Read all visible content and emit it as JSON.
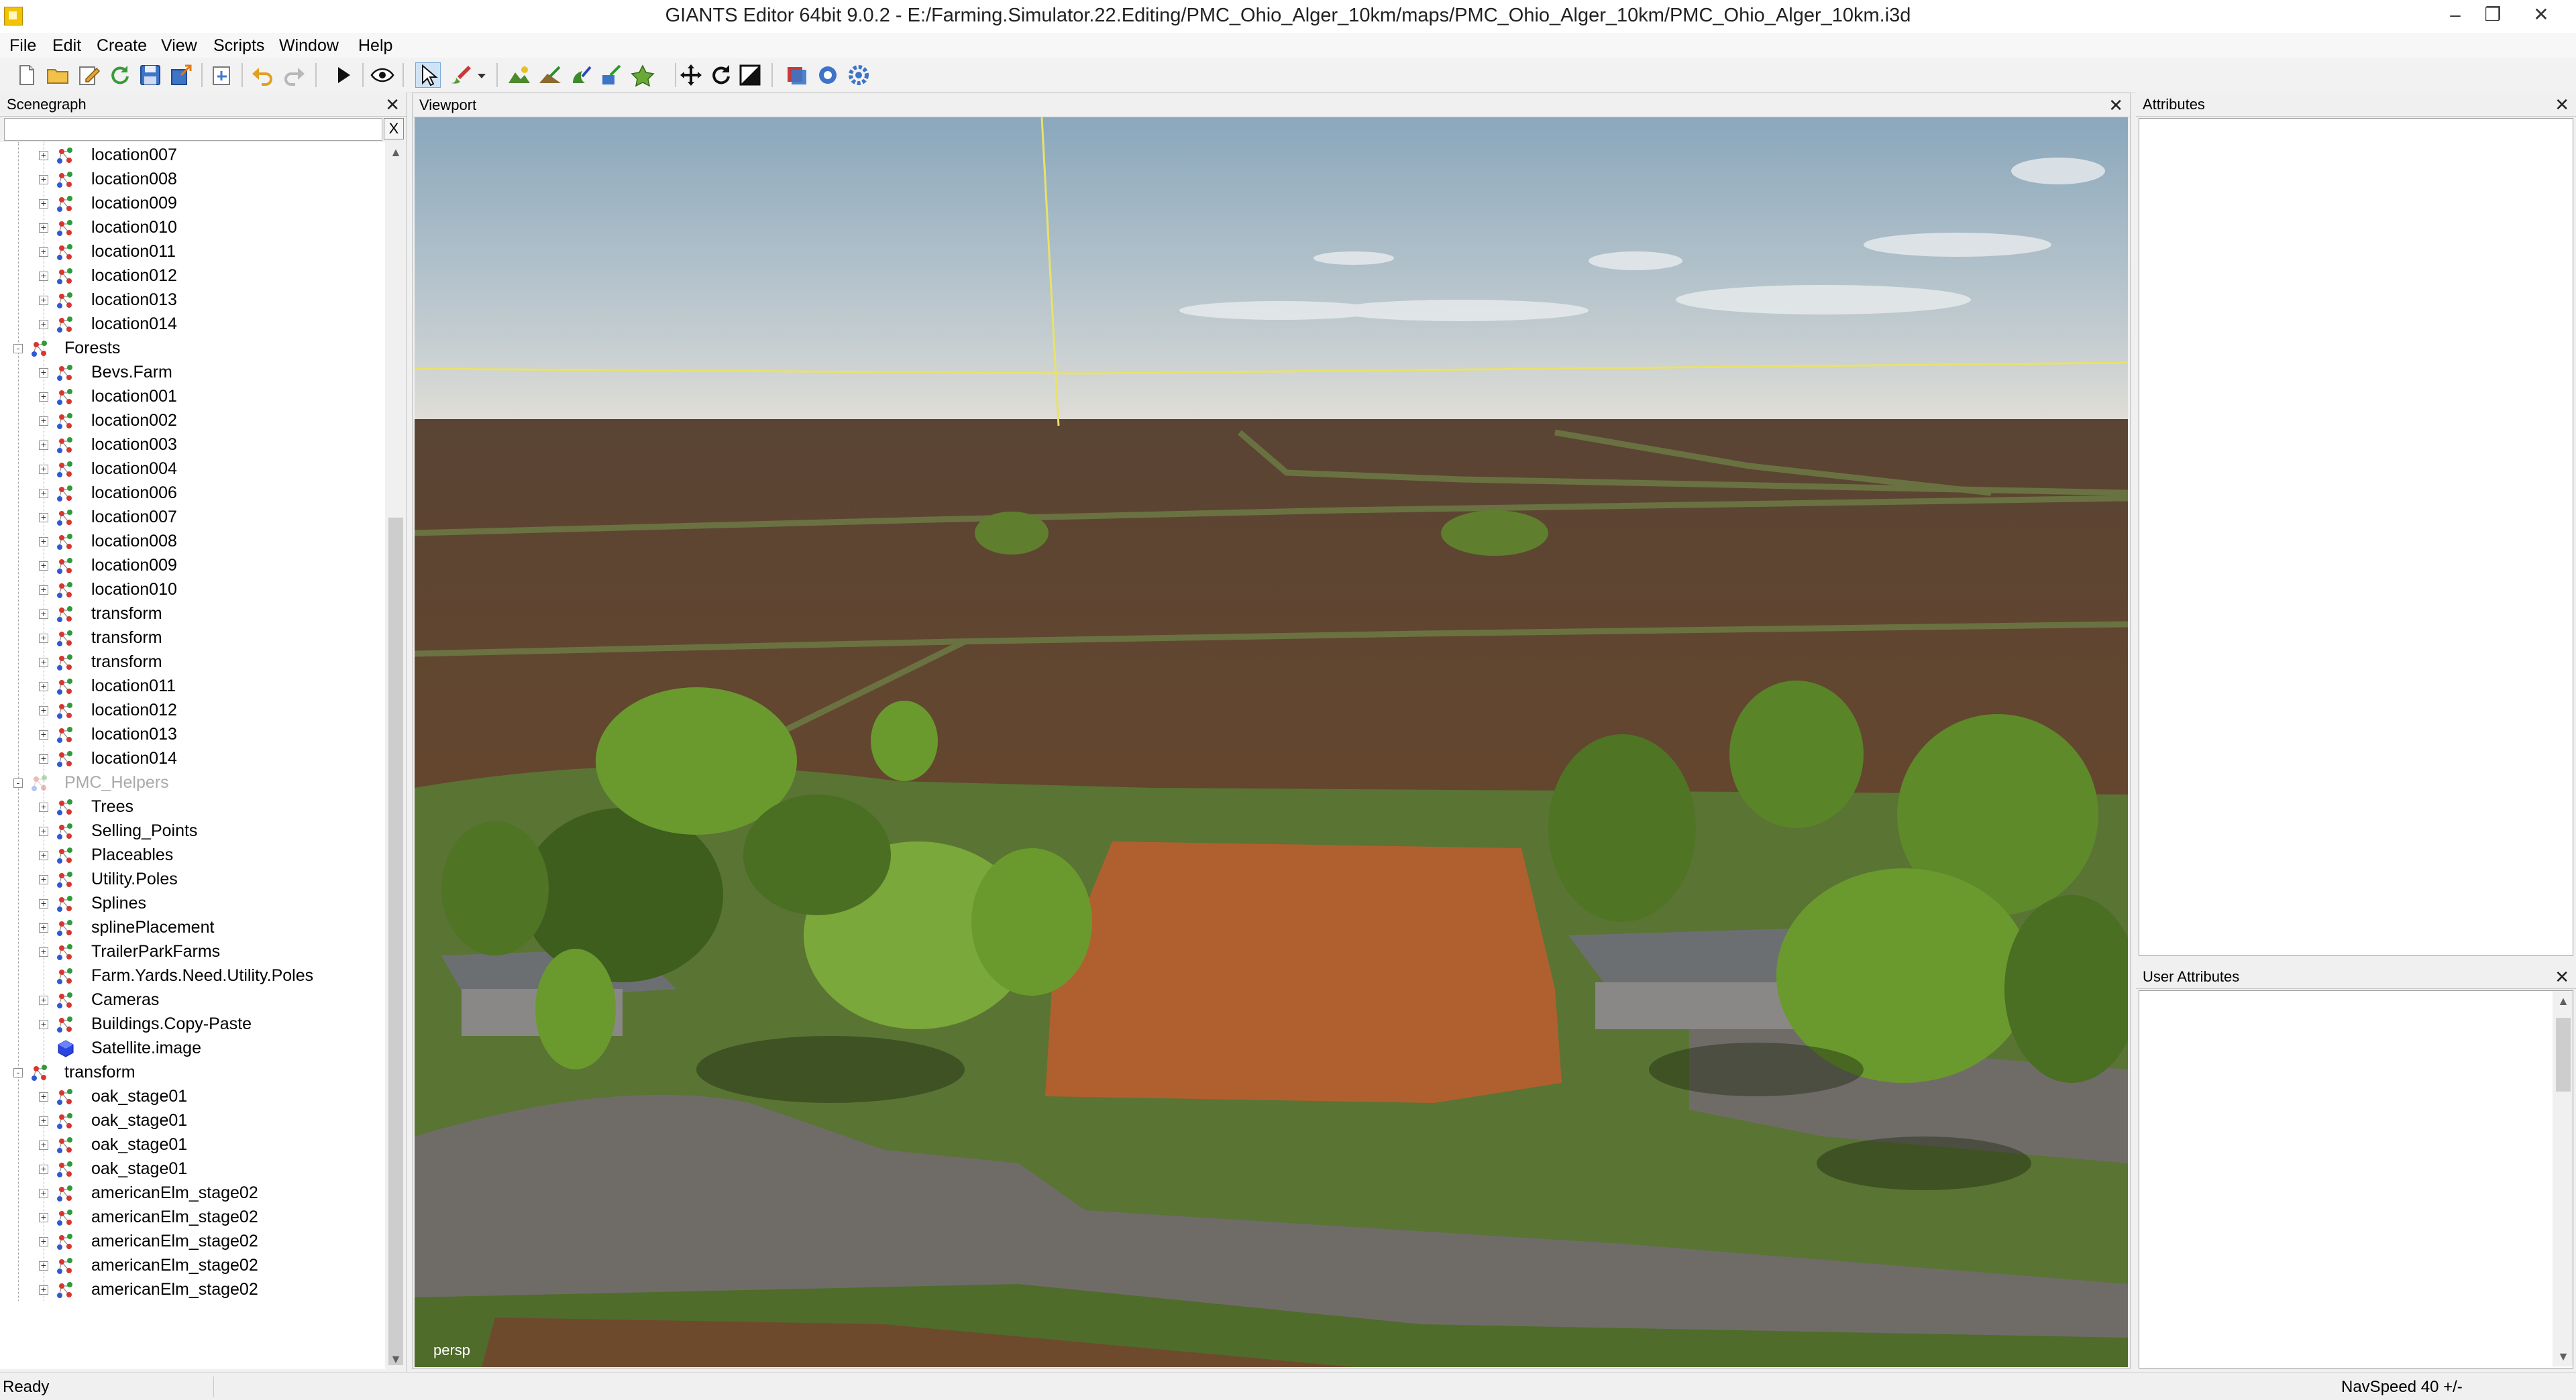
{
  "window": {
    "title": "GIANTS Editor 64bit 9.0.2 - E:/Farming.Simulator.22.Editing/PMC_Ohio_Alger_10km/maps/PMC_Ohio_Alger_10km/PMC_Ohio_Alger_10km.i3d",
    "minimize_glyph": "–",
    "restore_glyph": "❐",
    "close_glyph": "✕"
  },
  "menu": [
    "File",
    "Edit",
    "Create",
    "View",
    "Scripts",
    "Window",
    "Help"
  ],
  "toolbar": {
    "icons": [
      "new-icon",
      "open-icon",
      "edit-icon",
      "refresh-icon",
      "save-icon",
      "export-icon",
      "import-icon",
      "undo-icon",
      "redo-icon",
      "play-icon",
      "eye-icon",
      "select-icon",
      "paint-icon",
      "dropdown-icon",
      "terrain-sculpt-icon",
      "terrain-paint-icon",
      "foliage-paint-icon",
      "decal-icon",
      "placement-icon",
      "move-icon",
      "rotate-icon",
      "scale-icon",
      "material-icon",
      "settings-icon",
      "gear-icon"
    ]
  },
  "scenegraph": {
    "title": "Scenegraph",
    "close_glyph": "✕",
    "search_placeholder": "",
    "clear_label": "X",
    "rows": [
      {
        "label": "location007",
        "level": 1,
        "expander": "+",
        "icon": "transform"
      },
      {
        "label": "location008",
        "level": 1,
        "expander": "+",
        "icon": "transform"
      },
      {
        "label": "location009",
        "level": 1,
        "expander": "+",
        "icon": "transform"
      },
      {
        "label": "location010",
        "level": 1,
        "expander": "+",
        "icon": "transform"
      },
      {
        "label": "location011",
        "level": 1,
        "expander": "+",
        "icon": "transform"
      },
      {
        "label": "location012",
        "level": 1,
        "expander": "+",
        "icon": "transform"
      },
      {
        "label": "location013",
        "level": 1,
        "expander": "+",
        "icon": "transform"
      },
      {
        "label": "location014",
        "level": 1,
        "expander": "+",
        "icon": "transform"
      },
      {
        "label": "Forests",
        "level": 0,
        "expander": "-",
        "icon": "transform"
      },
      {
        "label": "Bevs.Farm",
        "level": 1,
        "expander": "+",
        "icon": "transform"
      },
      {
        "label": "location001",
        "level": 1,
        "expander": "+",
        "icon": "transform"
      },
      {
        "label": "location002",
        "level": 1,
        "expander": "+",
        "icon": "transform"
      },
      {
        "label": "location003",
        "level": 1,
        "expander": "+",
        "icon": "transform"
      },
      {
        "label": "location004",
        "level": 1,
        "expander": "+",
        "icon": "transform"
      },
      {
        "label": "location006",
        "level": 1,
        "expander": "+",
        "icon": "transform"
      },
      {
        "label": "location007",
        "level": 1,
        "expander": "+",
        "icon": "transform"
      },
      {
        "label": "location008",
        "level": 1,
        "expander": "+",
        "icon": "transform"
      },
      {
        "label": "location009",
        "level": 1,
        "expander": "+",
        "icon": "transform"
      },
      {
        "label": "location010",
        "level": 1,
        "expander": "+",
        "icon": "transform"
      },
      {
        "label": "transform",
        "level": 1,
        "expander": "+",
        "icon": "transform"
      },
      {
        "label": "transform",
        "level": 1,
        "expander": "+",
        "icon": "transform"
      },
      {
        "label": "transform",
        "level": 1,
        "expander": "+",
        "icon": "transform"
      },
      {
        "label": "location011",
        "level": 1,
        "expander": "+",
        "icon": "transform"
      },
      {
        "label": "location012",
        "level": 1,
        "expander": "+",
        "icon": "transform"
      },
      {
        "label": "location013",
        "level": 1,
        "expander": "+",
        "icon": "transform"
      },
      {
        "label": "location014",
        "level": 1,
        "expander": "+",
        "icon": "transform"
      },
      {
        "label": "PMC_Helpers",
        "level": 0,
        "expander": "-",
        "icon": "transform-hidden",
        "dim": true
      },
      {
        "label": "Trees",
        "level": 1,
        "expander": "+",
        "icon": "transform"
      },
      {
        "label": "Selling_Points",
        "level": 1,
        "expander": "+",
        "icon": "transform"
      },
      {
        "label": "Placeables",
        "level": 1,
        "expander": "+",
        "icon": "transform"
      },
      {
        "label": "Utility.Poles",
        "level": 1,
        "expander": "+",
        "icon": "transform"
      },
      {
        "label": "Splines",
        "level": 1,
        "expander": "+",
        "icon": "transform"
      },
      {
        "label": "splinePlacement",
        "level": 1,
        "expander": "+",
        "icon": "transform"
      },
      {
        "label": "TrailerParkFarms",
        "level": 1,
        "expander": "+",
        "icon": "transform"
      },
      {
        "label": "Farm.Yards.Need.Utility.Poles",
        "level": 1,
        "expander": "",
        "icon": "transform"
      },
      {
        "label": "Cameras",
        "level": 1,
        "expander": "+",
        "icon": "transform"
      },
      {
        "label": "Buildings.Copy-Paste",
        "level": 1,
        "expander": "+",
        "icon": "transform"
      },
      {
        "label": "Satellite.image",
        "level": 1,
        "expander": "",
        "icon": "shape"
      },
      {
        "label": "transform",
        "level": 0,
        "expander": "-",
        "icon": "transform"
      },
      {
        "label": "oak_stage01",
        "level": 1,
        "expander": "+",
        "icon": "transform"
      },
      {
        "label": "oak_stage01",
        "level": 1,
        "expander": "+",
        "icon": "transform"
      },
      {
        "label": "oak_stage01",
        "level": 1,
        "expander": "+",
        "icon": "transform"
      },
      {
        "label": "oak_stage01",
        "level": 1,
        "expander": "+",
        "icon": "transform"
      },
      {
        "label": "americanElm_stage02",
        "level": 1,
        "expander": "+",
        "icon": "transform"
      },
      {
        "label": "americanElm_stage02",
        "level": 1,
        "expander": "+",
        "icon": "transform"
      },
      {
        "label": "americanElm_stage02",
        "level": 1,
        "expander": "+",
        "icon": "transform"
      },
      {
        "label": "americanElm_stage02",
        "level": 1,
        "expander": "+",
        "icon": "transform"
      },
      {
        "label": "americanElm_stage02",
        "level": 1,
        "expander": "+",
        "icon": "transform"
      }
    ]
  },
  "viewport": {
    "title": "Viewport",
    "close_glyph": "✕",
    "camera_label": "persp"
  },
  "attributes": {
    "title": "Attributes",
    "close_glyph": "✕"
  },
  "user_attributes": {
    "title": "User Attributes",
    "close_glyph": "✕"
  },
  "status": {
    "text": "Ready",
    "navspeed": "NavSpeed 40 +/-"
  },
  "colors": {
    "sky": "#9fb6c6",
    "field": "#6e4a2c",
    "grass": "#5d7a36",
    "crop": "#b8632e",
    "guide_line": "#e8e26a",
    "road": "#7a7670"
  }
}
